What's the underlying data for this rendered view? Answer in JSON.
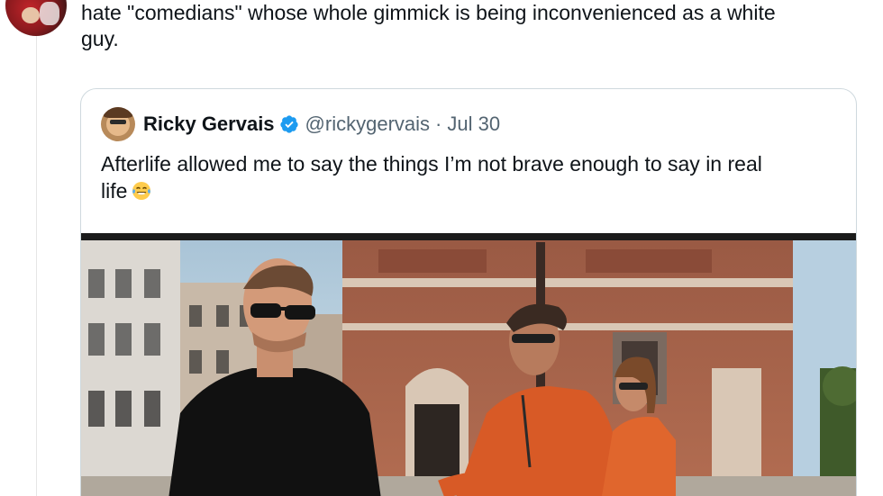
{
  "reply": {
    "text_lines": [
      "hate \"comedians\" whose whole gimmick is being inconvenienced as a white",
      "guy."
    ]
  },
  "quoted_tweet": {
    "display_name": "Ricky Gervais",
    "handle": "@rickygervais",
    "separator": "·",
    "date": "Jul 30",
    "text_lines": [
      "Afterlife allowed me to say the things I’m not brave enough to say in real",
      "life"
    ],
    "emoji": "face-with-tears-of-joy"
  },
  "colors": {
    "text": "#0f1419",
    "secondary": "#536471",
    "border": "#cfd9de",
    "verified": "#1d9bf0"
  }
}
